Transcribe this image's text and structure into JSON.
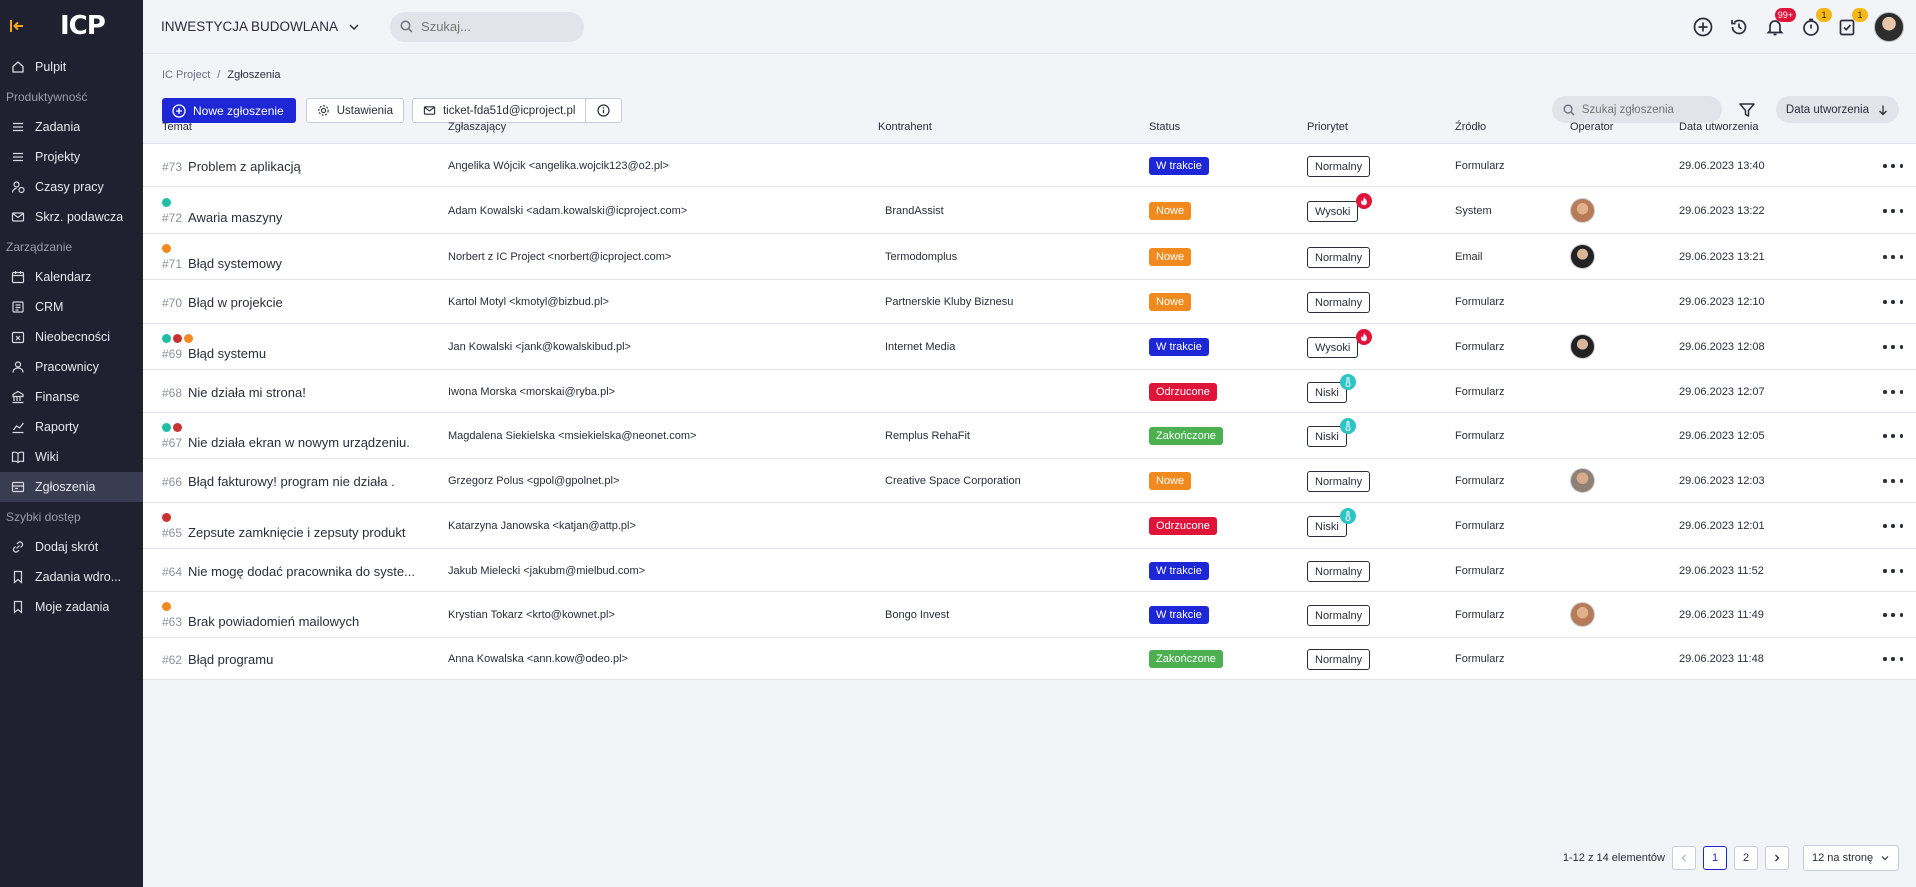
{
  "sidebar": {
    "logo": "ICP",
    "items_top": [
      {
        "label": "Pulpit",
        "icon": "home-icon"
      }
    ],
    "section_productivity": "Produktywność",
    "items_productivity": [
      {
        "label": "Zadania",
        "icon": "list-icon"
      },
      {
        "label": "Projekty",
        "icon": "list-icon"
      },
      {
        "label": "Czasy pracy",
        "icon": "user-clock-icon"
      },
      {
        "label": "Skrz. podawcza",
        "icon": "mail-icon"
      }
    ],
    "section_management": "Zarządzanie",
    "items_management": [
      {
        "label": "Kalendarz",
        "icon": "calendar-icon"
      },
      {
        "label": "CRM",
        "icon": "crm-icon"
      },
      {
        "label": "Nieobecności",
        "icon": "absence-icon"
      },
      {
        "label": "Pracownicy",
        "icon": "users-icon"
      },
      {
        "label": "Finanse",
        "icon": "finance-icon"
      },
      {
        "label": "Raporty",
        "icon": "chart-icon"
      },
      {
        "label": "Wiki",
        "icon": "book-icon"
      },
      {
        "label": "Zgłoszenia",
        "icon": "tickets-icon",
        "active": true
      }
    ],
    "section_quick": "Szybki dostęp",
    "items_quick": [
      {
        "label": "Dodaj skrót",
        "icon": "link-icon"
      },
      {
        "label": "Zadania wdro...",
        "icon": "bookmark-icon"
      },
      {
        "label": "Moje zadania",
        "icon": "bookmark-icon"
      }
    ]
  },
  "topbar": {
    "project": "INWESTYCJA BUDOWLANA",
    "search_placeholder": "Szukaj...",
    "notifications_badge": "99+",
    "alerts_badge": "1",
    "tasks_badge": "1"
  },
  "breadcrumb": {
    "root": "IC Project",
    "sep": "/",
    "current": "Zgłoszenia"
  },
  "toolbar": {
    "new_label": "Nowe zgłoszenie",
    "settings_label": "Ustawienia",
    "email_label": "ticket-fda51d@icproject.pl",
    "search_placeholder": "Szukaj zgłoszenia",
    "sort_label": "Data utworzenia"
  },
  "table": {
    "headers": {
      "subject": "Temat",
      "reporter": "Zgłaszający",
      "contractor": "Kontrahent",
      "status": "Status",
      "priority": "Priorytet",
      "source": "Źródło",
      "operator": "Operator",
      "created": "Data utworzenia"
    },
    "rows": [
      {
        "num": "#73",
        "title": "Problem z aplikacją",
        "dots": [],
        "reporter": "Angelika Wójcik <angelika.wojcik123@o2.pl>",
        "contractor": "",
        "status": "W trakcie",
        "status_color": "#1d27d6",
        "priority": "Normalny",
        "prio_icon": "",
        "source": "Formularz",
        "operator": "",
        "created": "29.06.2023 13:40"
      },
      {
        "num": "#72",
        "title": "Awaria maszyny",
        "dots": [
          "#1fbfa6"
        ],
        "reporter": "Adam Kowalski <adam.kowalski@icproject.com>",
        "contractor": "BrandAssist",
        "status": "Nowe",
        "status_color": "#f08a1e",
        "priority": "Wysoki",
        "prio_icon": "hot",
        "source": "System",
        "operator": "av-a",
        "created": "29.06.2023 13:22"
      },
      {
        "num": "#71",
        "title": "Błąd systemowy",
        "dots": [
          "#f08a1e"
        ],
        "reporter": "Norbert z IC Project <norbert@icproject.com>",
        "contractor": "Termodomplus",
        "status": "Nowe",
        "status_color": "#f08a1e",
        "priority": "Normalny",
        "prio_icon": "",
        "source": "Email",
        "operator": "av-b",
        "created": "29.06.2023 13:21"
      },
      {
        "num": "#70",
        "title": "Błąd w projekcie",
        "dots": [],
        "reporter": "Kartol Motyl <kmotyl@bizbud.pl>",
        "contractor": "Partnerskie Kluby Biznesu",
        "status": "Nowe",
        "status_color": "#f08a1e",
        "priority": "Normalny",
        "prio_icon": "",
        "source": "Formularz",
        "operator": "",
        "created": "29.06.2023 12:10"
      },
      {
        "num": "#69",
        "title": "Błąd systemu",
        "dots": [
          "#1fbfa6",
          "#c83232",
          "#f08a1e"
        ],
        "reporter": "Jan Kowalski <jank@kowalskibud.pl>",
        "contractor": "Internet Media",
        "status": "W trakcie",
        "status_color": "#1d27d6",
        "priority": "Wysoki",
        "prio_icon": "hot",
        "source": "Formularz",
        "operator": "av-b",
        "created": "29.06.2023 12:08"
      },
      {
        "num": "#68",
        "title": "Nie działa mi strona!",
        "dots": [],
        "reporter": "Iwona Morska <morskai@ryba.pl>",
        "contractor": "",
        "status": "Odrzucone",
        "status_color": "#e0133b",
        "priority": "Niski",
        "prio_icon": "cold",
        "source": "Formularz",
        "operator": "",
        "created": "29.06.2023 12:07"
      },
      {
        "num": "#67",
        "title": "Nie działa ekran w nowym urządzeniu.",
        "dots": [
          "#1fbfa6",
          "#c83232"
        ],
        "reporter": "Magdalena Siekielska <msiekielska@neonet.com>",
        "contractor": "Remplus RehaFit",
        "status": "Zakończone",
        "status_color": "#4caf50",
        "priority": "Niski",
        "prio_icon": "cold",
        "source": "Formularz",
        "operator": "",
        "created": "29.06.2023 12:05"
      },
      {
        "num": "#66",
        "title": "Błąd fakturowy! program nie działa .",
        "dots": [],
        "reporter": "Grzegorz Polus <gpol@gpolnet.pl>",
        "contractor": "Creative Space Corporation",
        "status": "Nowe",
        "status_color": "#f08a1e",
        "priority": "Normalny",
        "prio_icon": "",
        "source": "Formularz",
        "operator": "av-c",
        "created": "29.06.2023 12:03"
      },
      {
        "num": "#65",
        "title": "Zepsute zamknięcie i zepsuty produkt",
        "dots": [
          "#c83232"
        ],
        "reporter": "Katarzyna Janowska <katjan@attp.pl>",
        "contractor": "",
        "status": "Odrzucone",
        "status_color": "#e0133b",
        "priority": "Niski",
        "prio_icon": "cold",
        "source": "Formularz",
        "operator": "",
        "created": "29.06.2023 12:01"
      },
      {
        "num": "#64",
        "title": "Nie mogę dodać pracownika do syste...",
        "dots": [],
        "reporter": "Jakub Mielecki <jakubm@mielbud.com>",
        "contractor": "",
        "status": "W trakcie",
        "status_color": "#1d27d6",
        "priority": "Normalny",
        "prio_icon": "",
        "source": "Formularz",
        "operator": "",
        "created": "29.06.2023 11:52"
      },
      {
        "num": "#63",
        "title": "Brak powiadomień mailowych",
        "dots": [
          "#f08a1e"
        ],
        "reporter": "Krystian Tokarz <krto@kownet.pl>",
        "contractor": "Bongo Invest",
        "status": "W trakcie",
        "status_color": "#1d27d6",
        "priority": "Normalny",
        "prio_icon": "",
        "source": "Formularz",
        "operator": "av-a",
        "created": "29.06.2023 11:49"
      },
      {
        "num": "#62",
        "title": "Błąd programu",
        "dots": [],
        "reporter": "Anna Kowalska <ann.kow@odeo.pl>",
        "contractor": "",
        "status": "Zakończone",
        "status_color": "#4caf50",
        "priority": "Normalny",
        "prio_icon": "",
        "source": "Formularz",
        "operator": "",
        "created": "29.06.2023 11:48"
      }
    ]
  },
  "pager": {
    "range": "1-12 z 14 elementów",
    "page1": "1",
    "page2": "2",
    "page_size": "12 na stronę"
  }
}
